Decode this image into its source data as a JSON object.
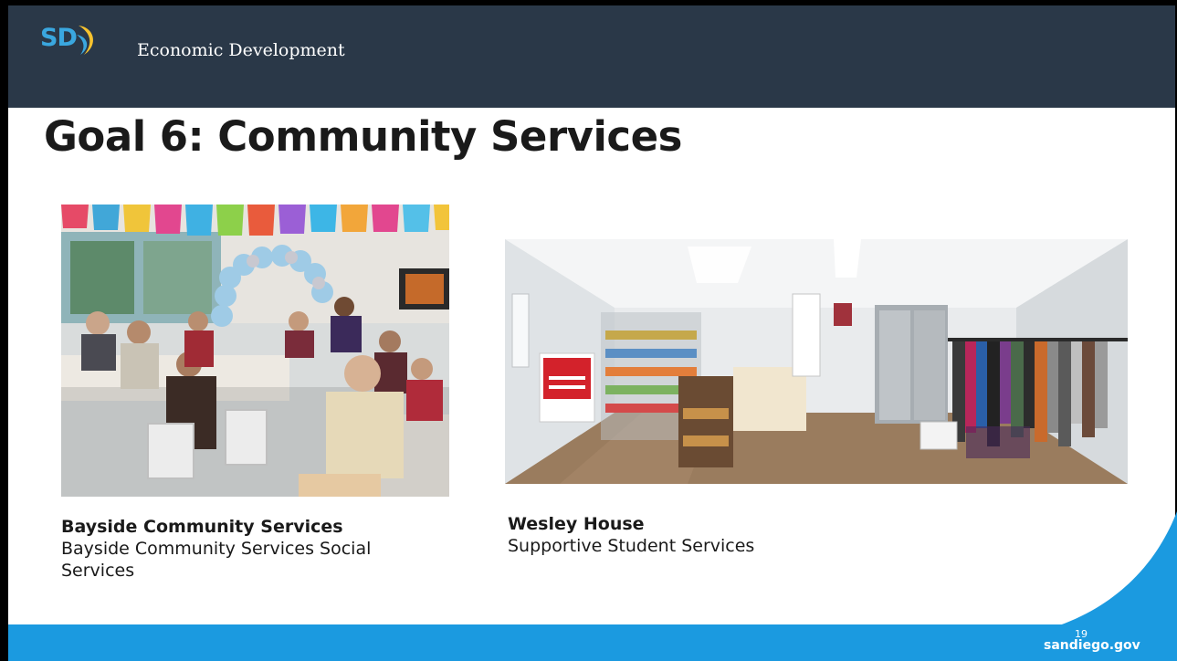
{
  "header": {
    "logo_text": "SD",
    "department": "Economic Development"
  },
  "slide": {
    "title": "Goal 6: Community Services",
    "items": [
      {
        "name": "Bayside Community Services",
        "description": "Bayside Community Services Social Services"
      },
      {
        "name": "Wesley House",
        "description": "Supportive Student Services"
      }
    ]
  },
  "footer": {
    "site": "sandiego.gov",
    "page_number": "19"
  },
  "colors": {
    "header_bg": "#2a3848",
    "footer_blue": "#1b9ae0",
    "logo_blue": "#3aa7df",
    "logo_yellow": "#f6c22e"
  }
}
